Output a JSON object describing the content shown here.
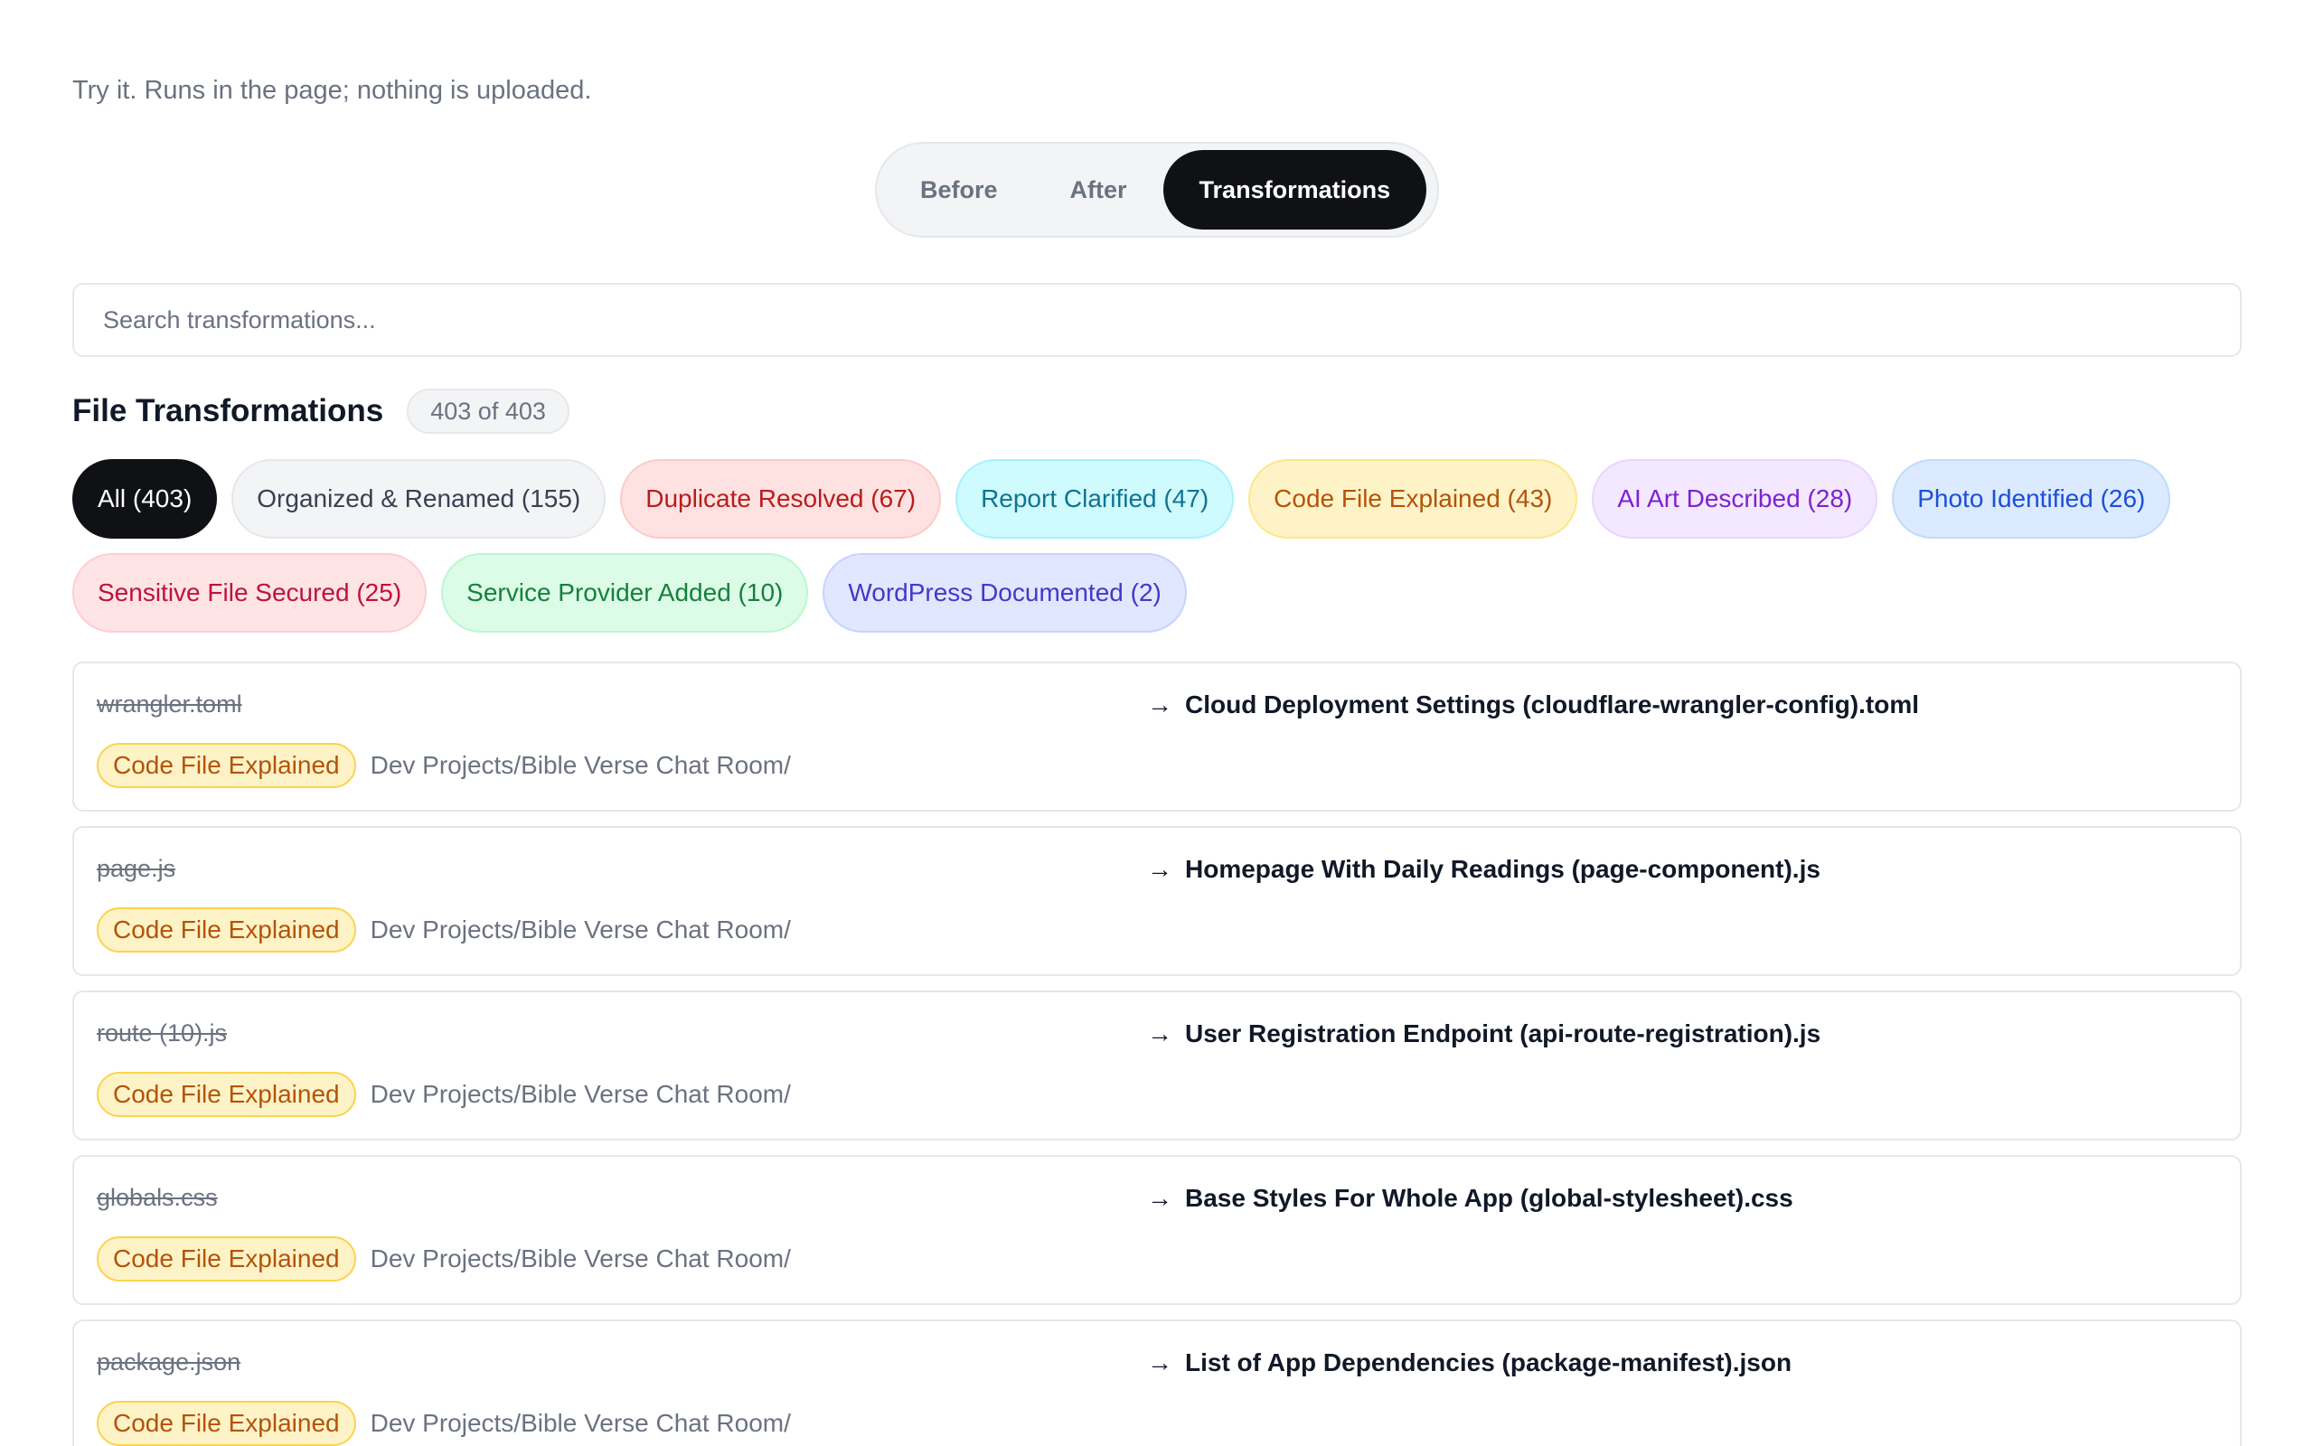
{
  "intro_text": "Try it. Runs in the page; nothing is uploaded.",
  "view_toggle": {
    "before": "Before",
    "after": "After",
    "transformations": "Transformations",
    "selected": "transformations"
  },
  "search": {
    "placeholder": "Search transformations...",
    "value": ""
  },
  "section": {
    "title": "File Transformations",
    "count": "403 of 403"
  },
  "filters": [
    {
      "label": "All (403)",
      "active": true,
      "bg": "#0f1115",
      "border": "#0f1115",
      "color": "#ffffff"
    },
    {
      "label": "Organized & Renamed (155)",
      "active": false,
      "bg": "#f3f4f6",
      "border": "#e5e7eb",
      "color": "#374151"
    },
    {
      "label": "Duplicate Resolved (67)",
      "active": false,
      "bg": "#fee2e2",
      "border": "#fecaca",
      "color": "#b91c1c"
    },
    {
      "label": "Report Clarified (47)",
      "active": false,
      "bg": "#cffafe",
      "border": "#a5f3fc",
      "color": "#0e7490"
    },
    {
      "label": "Code File Explained (43)",
      "active": false,
      "bg": "#fef3c7",
      "border": "#fde68a",
      "color": "#b45309"
    },
    {
      "label": "AI Art Described (28)",
      "active": false,
      "bg": "#f3e8ff",
      "border": "#e9d5ff",
      "color": "#7e22ce"
    },
    {
      "label": "Photo Identified (26)",
      "active": false,
      "bg": "#dbeafe",
      "border": "#bfdbfe",
      "color": "#1d4ed8"
    },
    {
      "label": "Sensitive File Secured (25)",
      "active": false,
      "bg": "#ffe4e6",
      "border": "#fecdd3",
      "color": "#be123c"
    },
    {
      "label": "Service Provider Added (10)",
      "active": false,
      "bg": "#dcfce7",
      "border": "#bbf7d0",
      "color": "#15803d"
    },
    {
      "label": "WordPress Documented (2)",
      "active": false,
      "bg": "#e0e7ff",
      "border": "#c7d2fe",
      "color": "#4338ca"
    }
  ],
  "transformations": [
    {
      "old_name": "wrangler.toml",
      "arrow": "→",
      "new_name": "Cloud Deployment Settings (cloudflare-wrangler-config).toml",
      "tag": "Code File Explained",
      "path": "Dev Projects/Bible Verse Chat Room/"
    },
    {
      "old_name": "page.js",
      "arrow": "→",
      "new_name": "Homepage With Daily Readings (page-component).js",
      "tag": "Code File Explained",
      "path": "Dev Projects/Bible Verse Chat Room/"
    },
    {
      "old_name": "route (10).js",
      "arrow": "→",
      "new_name": "User Registration Endpoint (api-route-registration).js",
      "tag": "Code File Explained",
      "path": "Dev Projects/Bible Verse Chat Room/"
    },
    {
      "old_name": "globals.css",
      "arrow": "→",
      "new_name": "Base Styles For Whole App (global-stylesheet).css",
      "tag": "Code File Explained",
      "path": "Dev Projects/Bible Verse Chat Room/"
    },
    {
      "old_name": "package.json",
      "arrow": "→",
      "new_name": "List of App Dependencies (package-manifest).json",
      "tag": "Code File Explained",
      "path": "Dev Projects/Bible Verse Chat Room/"
    }
  ]
}
